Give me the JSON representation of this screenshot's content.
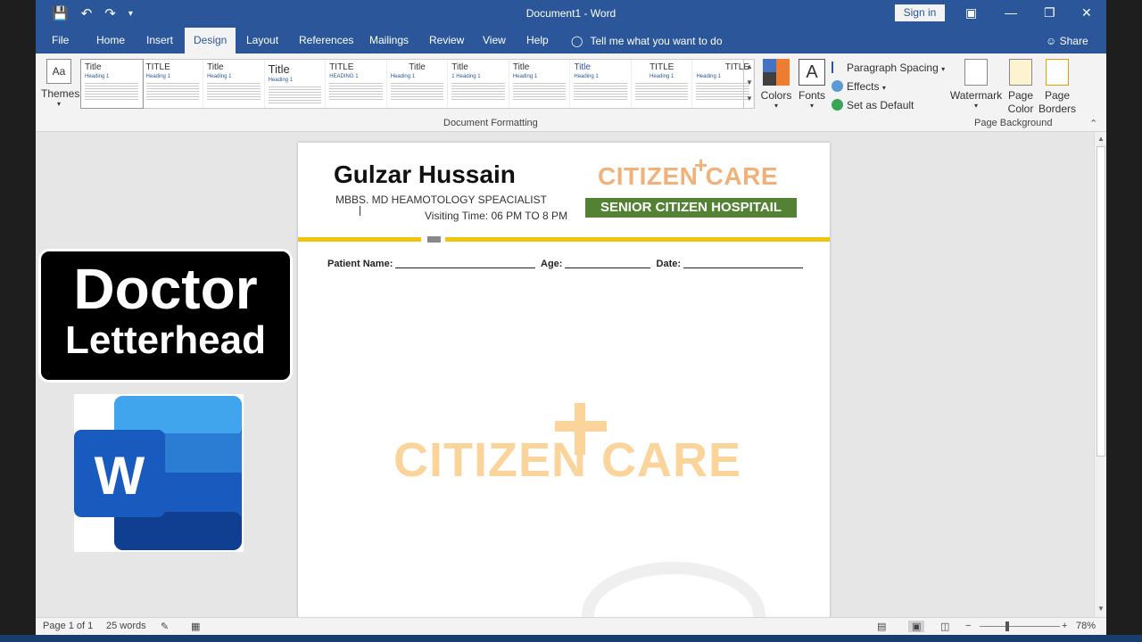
{
  "window": {
    "title": "Document1  -  Word",
    "sign_in": "Sign in"
  },
  "tabs": [
    "File",
    "Home",
    "Insert",
    "Design",
    "Layout",
    "References",
    "Mailings",
    "Review",
    "View",
    "Help"
  ],
  "active_tab": "Design",
  "tell_me": "Tell me what you want to do",
  "share": "Share",
  "ribbon": {
    "themes": "Themes",
    "style_thumbs": [
      {
        "title": "Title",
        "heading": "Heading 1"
      },
      {
        "title": "TITLE",
        "heading": "Heading 1"
      },
      {
        "title": "Title",
        "heading": "Heading 1"
      },
      {
        "title": "Title",
        "heading": "Heading 1"
      },
      {
        "title": "TITLE",
        "heading": "HEADING 1"
      },
      {
        "title": "Title",
        "heading": "Heading 1"
      },
      {
        "title": "Title",
        "heading": "1 Heading 1"
      },
      {
        "title": "Title",
        "heading": "Heading 1"
      },
      {
        "title": "Title",
        "heading": "Heading 1"
      },
      {
        "title": "TITLE",
        "heading": "Heading 1"
      },
      {
        "title": "TITLE",
        "heading": "Heading 1"
      }
    ],
    "document_formatting_label": "Document Formatting",
    "colors": "Colors",
    "fonts": "Fonts",
    "fonts_glyph": "A",
    "paragraph_spacing": "Paragraph Spacing",
    "effects": "Effects",
    "set_as_default": "Set as Default",
    "watermark": "Watermark",
    "page_color": "Page Color",
    "page_borders": "Page Borders",
    "page_background_label": "Page Background"
  },
  "document": {
    "doctor_name": "Gulzar Hussain",
    "qualification": "MBBS. MD HEAMOTOLOGY SPEACIALIST",
    "visiting": "Visiting Time: 06 PM TO 8 PM",
    "logo_text": "CITIZEN CARE",
    "hospital": "SENIOR CITIZEN HOSPITAIL",
    "patient_name_label": "Patient Name:",
    "age_label": "Age:",
    "date_label": "Date:",
    "watermark_text": "CITIZEN CARE"
  },
  "overlay": {
    "line1": "Doctor",
    "line2": "Letterhead",
    "word_logo_letter": "W"
  },
  "status": {
    "page": "Page 1 of 1",
    "words": "25 words",
    "zoom": "78%"
  },
  "colors": {
    "brand": "#2b579a",
    "logo_orange": "#f0b17a",
    "hospital_green": "#548235",
    "rule_yellow": "#f1c40f"
  }
}
